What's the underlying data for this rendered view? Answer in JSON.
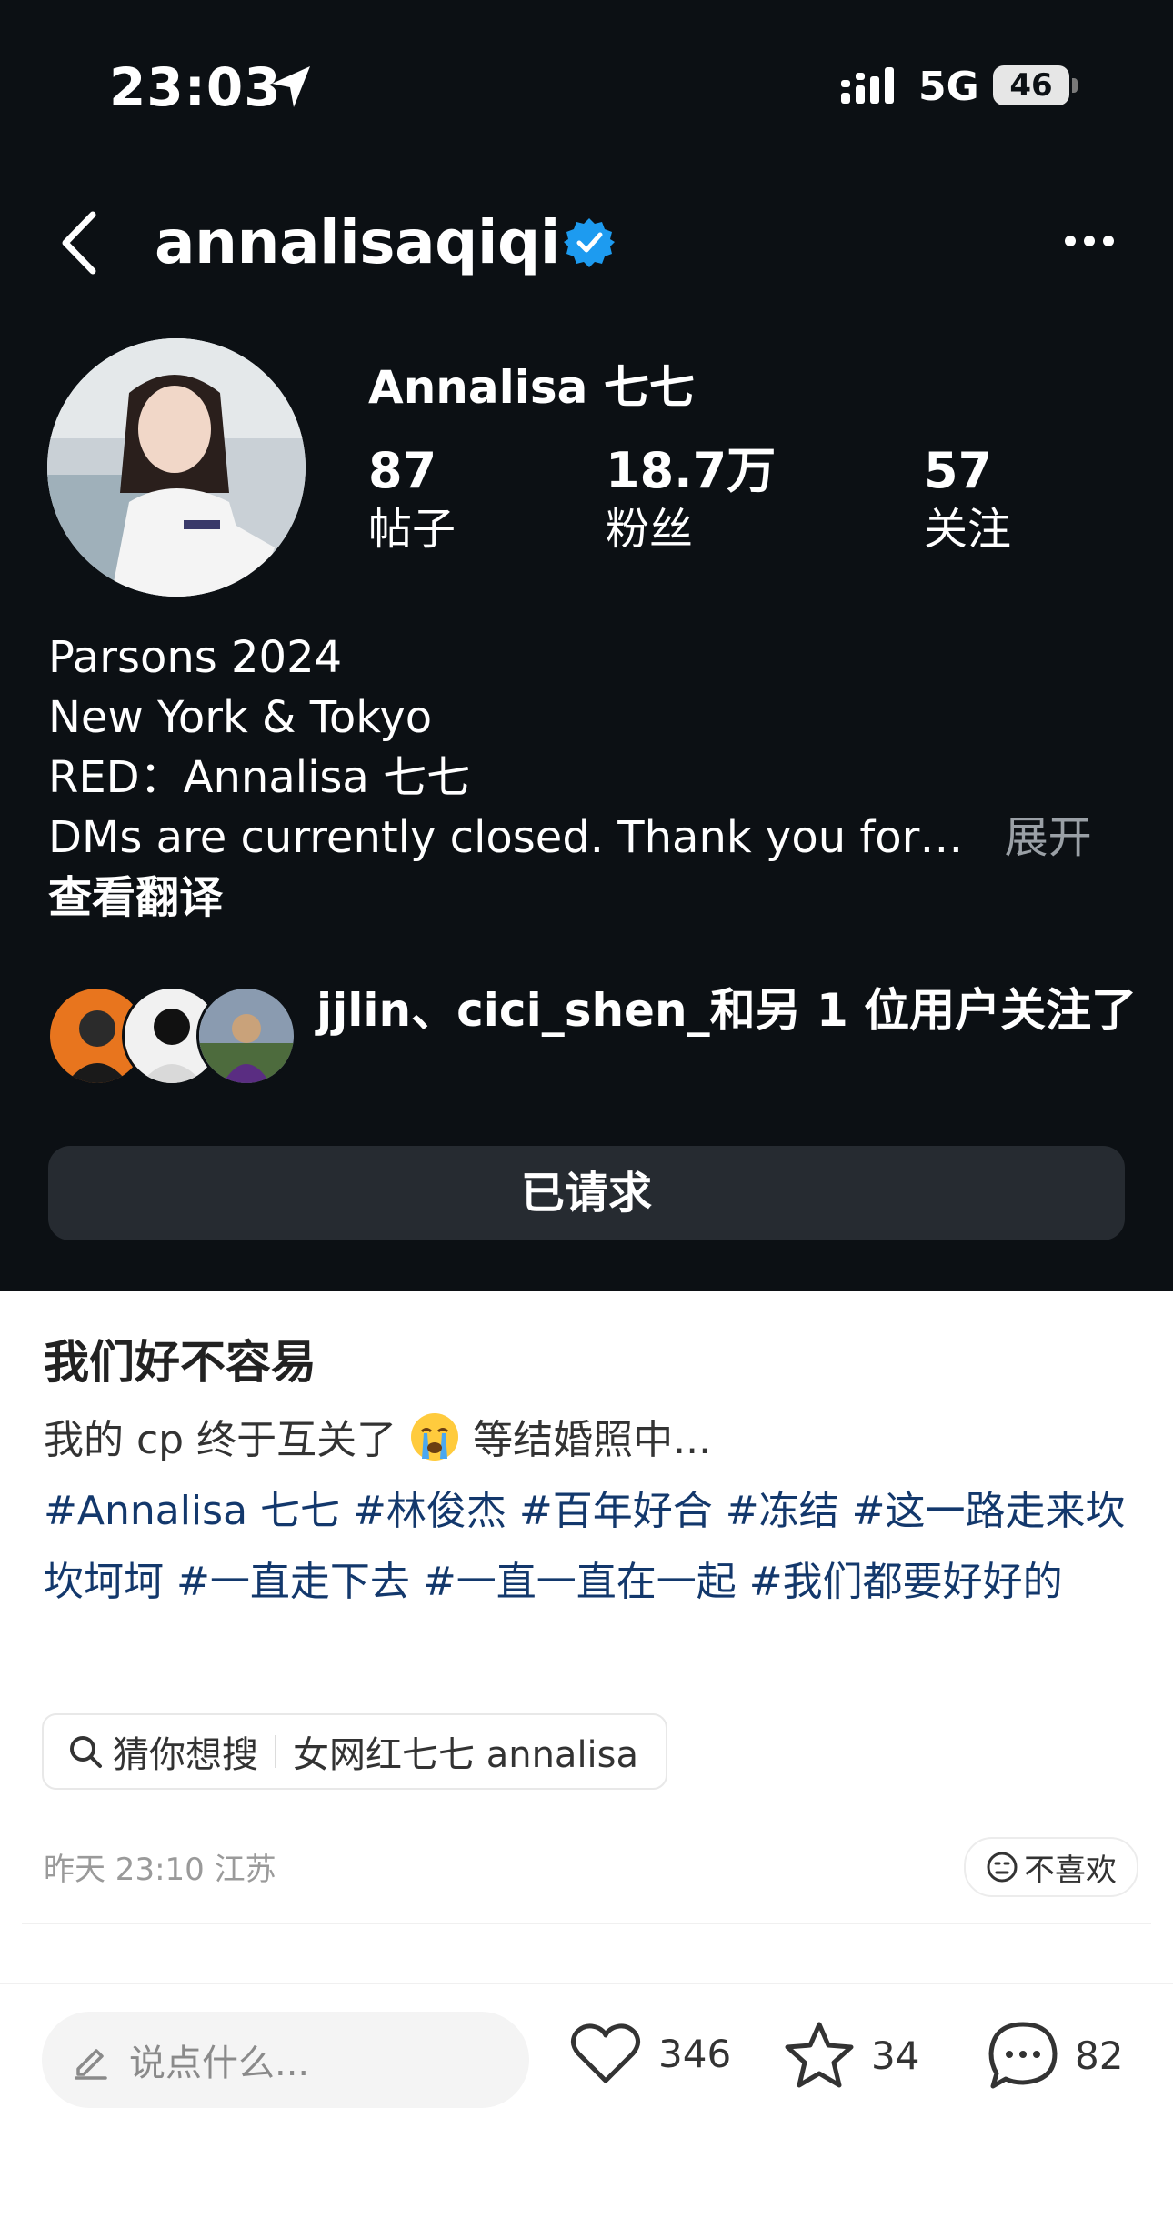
{
  "status_bar": {
    "time": "23:03",
    "network": "5G",
    "battery": "46"
  },
  "profile": {
    "username": "annalisaqiqi",
    "display_name": "Annalisa 七七",
    "stats": [
      {
        "value": "87",
        "label": "帖子"
      },
      {
        "value": "18.7万",
        "label": "粉丝"
      },
      {
        "value": "57",
        "label": "关注"
      }
    ],
    "bio": [
      "Parsons 2024",
      "New York & Tokyo",
      "RED：Annalisa 七七",
      "DMs are currently closed. Thank you for…"
    ],
    "bio_more": "展开",
    "translate": "查看翻译",
    "followed_by": "jjlin、cici_shen_和另 1 位用户关注了",
    "button_label": "已请求"
  },
  "post": {
    "title": "我们好不容易",
    "text_before_emoji": "我的 cp 终于互关了",
    "text_after_emoji": "等结婚照中...",
    "tags": [
      "#Annalisa 七七",
      "#林俊杰",
      "#百年好合",
      "#冻结",
      "#这一路走来坎坎坷坷",
      "#一直走下去",
      "#一直一直在一起",
      "#我们都要好好的"
    ],
    "search_chip": {
      "prefix": "猜你想搜",
      "query": "女网红七七 annalisa"
    },
    "meta": "昨天 23:10 江苏",
    "dislike_label": "不喜欢"
  },
  "bottom_bar": {
    "comment_placeholder": "说点什么...",
    "likes": "346",
    "favorites": "34",
    "comments": "82"
  }
}
